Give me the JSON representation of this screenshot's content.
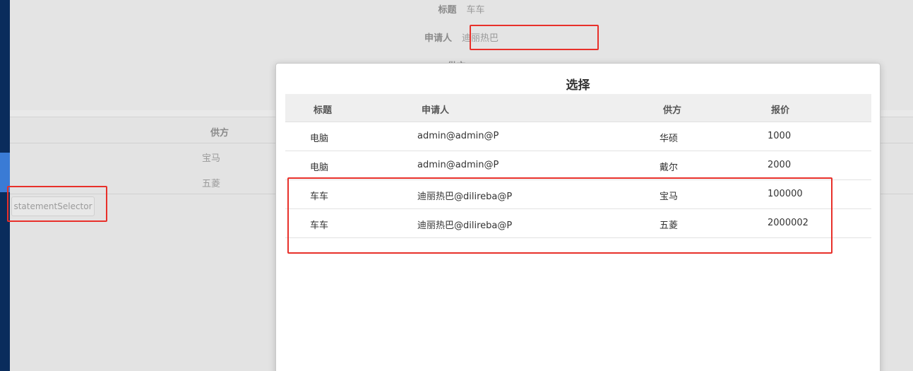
{
  "form": {
    "title_label": "标题",
    "title_value": "车车",
    "applicant_label": "申请人",
    "applicant_value": "迪丽热巴",
    "partial_label": "供方"
  },
  "background_table": {
    "header": "供方",
    "rows": [
      "宝马",
      "五菱"
    ]
  },
  "statement_button": "statementSelector",
  "modal": {
    "title": "选择",
    "columns": [
      "标题",
      "申请人",
      "供方",
      "报价"
    ],
    "rows": [
      [
        "电脑",
        "admin@admin@P",
        "华硕",
        "1000"
      ],
      [
        "电脑",
        "admin@admin@P",
        "戴尔",
        "2000"
      ],
      [
        "车车",
        "迪丽热巴@dilireba@P",
        "宝马",
        "100000"
      ],
      [
        "车车",
        "迪丽热巴@dilireba@P",
        "五菱",
        "2000002"
      ]
    ]
  },
  "colors": {
    "sidebar": "#0a2c5c",
    "highlight": "#e8302a",
    "header_bg": "#efefef"
  }
}
